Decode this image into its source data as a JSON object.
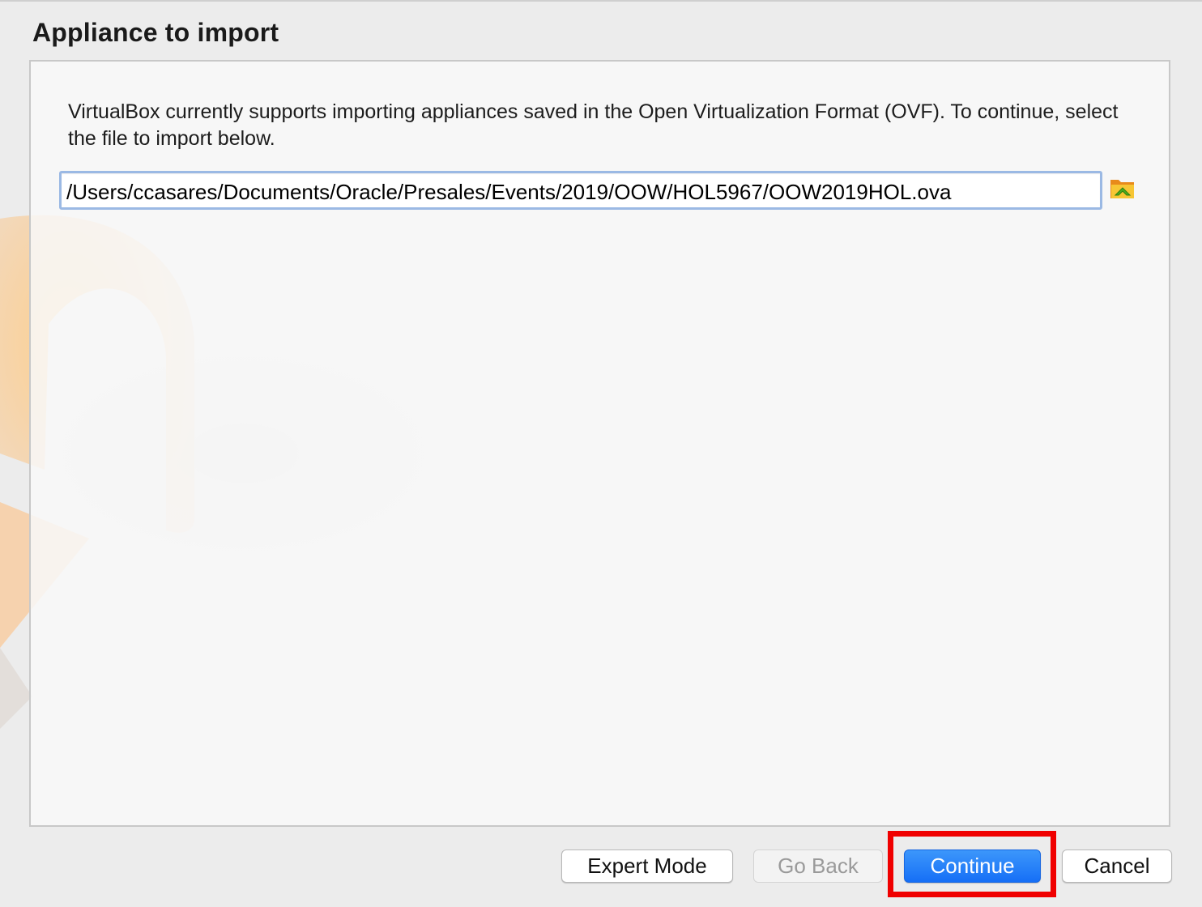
{
  "wizard": {
    "title": "Appliance to import",
    "description": "VirtualBox currently supports importing appliances saved in the Open Virtualization Format (OVF). To continue, select the file to import below.",
    "file_path": "/Users/ccasares/Documents/Oracle/Presales/Events/2019/OOW/HOL5967/OOW2019HOL.ova",
    "browse_icon": "folder-open-icon"
  },
  "footer": {
    "expert_mode_label": "Expert Mode",
    "go_back_label": "Go Back",
    "continue_label": "Continue",
    "cancel_label": "Cancel"
  },
  "annotation": {
    "highlight_color": "#f00000",
    "highlighted": "Continue"
  },
  "colors": {
    "primary_button": "#1a73f7",
    "field_focus": "#9bb9e4",
    "window_bg": "#ececec"
  }
}
